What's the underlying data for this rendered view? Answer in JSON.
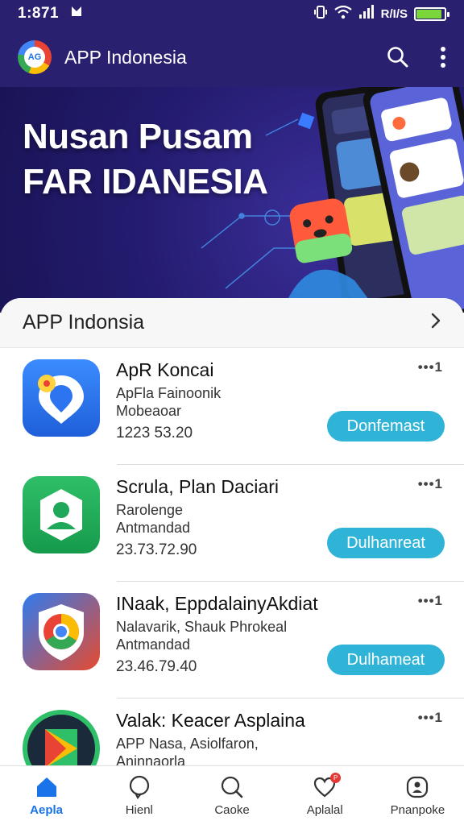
{
  "status_bar": {
    "time": "1:871",
    "carrier_text": "R/I/S",
    "battery_level": 0.9,
    "battery_color": "#7ad63a"
  },
  "app_bar": {
    "title": "APP Indonesia",
    "logo_text": "AG",
    "actions": [
      "search-icon",
      "more-vert-icon"
    ]
  },
  "hero": {
    "line1": "Nusan Pusam",
    "line2": "FAR IDANESIA"
  },
  "section": {
    "title": "APP Indonsia"
  },
  "apps": [
    {
      "name": "ApR Koncai",
      "sub1": "ApFla Fainoonik",
      "sub2": "Mobeaoar",
      "number": "1223 53.20",
      "rating": "•••1",
      "button": "Donfemast",
      "icon": "location-chat-icon"
    },
    {
      "name": "Scrula, Plan Daciari",
      "sub1": "Rarolenge",
      "sub2": "Antmandad",
      "number": "23.73.72.90",
      "rating": "•••1",
      "button": "Dulhanreat",
      "icon": "person-app-icon"
    },
    {
      "name": "INaak, EppdalainyAkdiat",
      "sub1": "Nalavarik, Shauk Phrokeal",
      "sub2": "Antmandad",
      "number": "23.46.79.40",
      "rating": "•••1",
      "button": "Dulhameat",
      "icon": "chrome-shield-icon"
    },
    {
      "name": "Valak: Keacer Asplaina",
      "sub1": "APP Nasa, Asiolfaron,",
      "sub2": "Aninnaorla",
      "number": "",
      "rating": "•••1",
      "button": "",
      "icon": "play-store-icon"
    }
  ],
  "bottom_nav": [
    {
      "label": "Aepla",
      "icon": "home-icon",
      "active": true
    },
    {
      "label": "Hienl",
      "icon": "chat-icon",
      "active": false
    },
    {
      "label": "Caoke",
      "icon": "search-icon",
      "active": false
    },
    {
      "label": "Aplalal",
      "icon": "heart-icon",
      "active": false,
      "badge": "P"
    },
    {
      "label": "Pnanpoke",
      "icon": "profile-icon",
      "active": false
    }
  ],
  "colors": {
    "brand": "#2a2070",
    "accent_button": "#2fb4d8",
    "active_nav": "#1a73e8"
  }
}
